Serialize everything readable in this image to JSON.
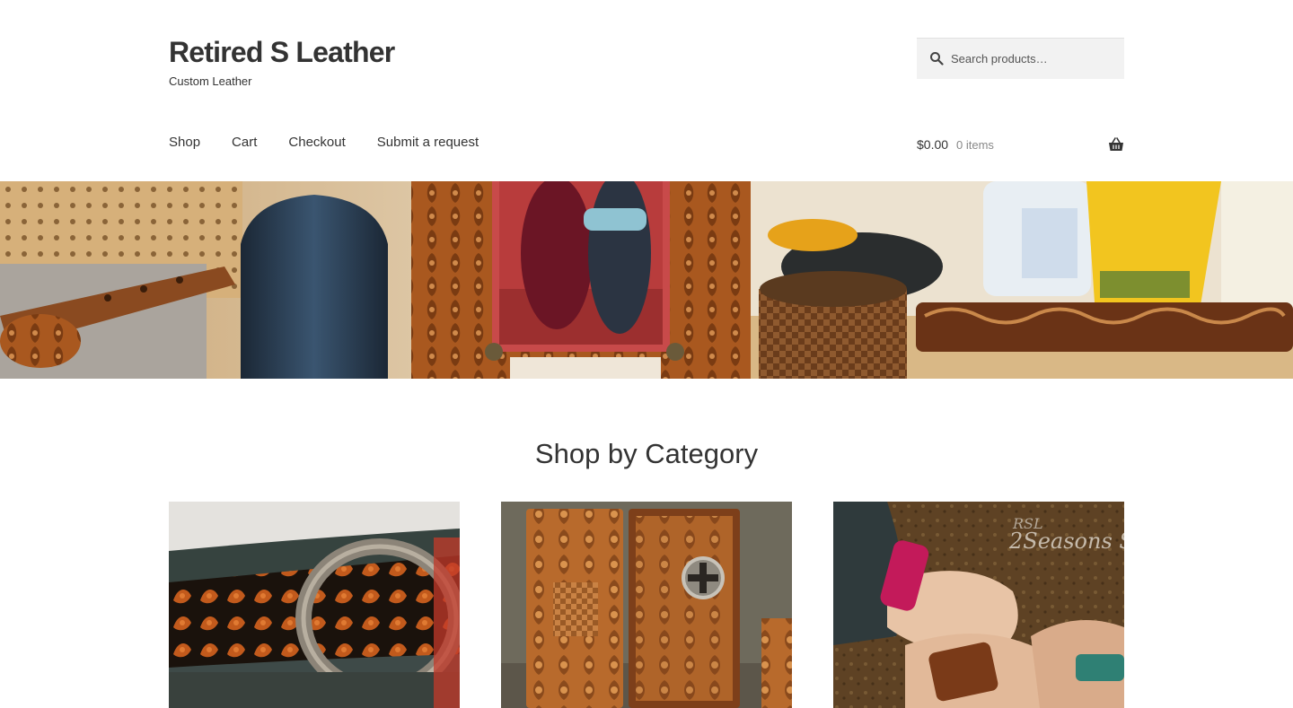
{
  "header": {
    "site_title": "Retired S Leather",
    "tagline": "Custom Leather",
    "search": {
      "placeholder": "Search products…"
    }
  },
  "nav": {
    "items": [
      "Shop",
      "Cart",
      "Checkout",
      "Submit a request"
    ]
  },
  "cart": {
    "amount": "$0.00",
    "items_count": "0 items"
  },
  "hero": {
    "image": "leather-workshop-banner"
  },
  "categories": {
    "title": "Shop by Category",
    "cards": [
      {
        "image": "tooled-belt-horseshoe-buckle"
      },
      {
        "image": "tooled-wallet-cross-concho"
      },
      {
        "image": "leather-cuff-bracelets",
        "watermark": "RSL 2Seasons S"
      }
    ]
  },
  "colors": {
    "text": "#333333",
    "muted": "#888888",
    "search_bg": "#f2f2f2",
    "leather": "#b5652a"
  }
}
